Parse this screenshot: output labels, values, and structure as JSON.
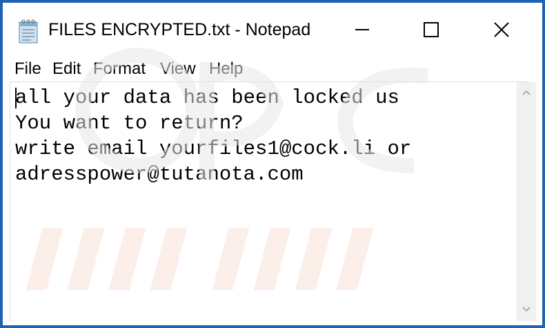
{
  "window": {
    "title": "FILES ENCRYPTED.txt - Notepad",
    "icon": "notepad-icon"
  },
  "controls": {
    "minimize_icon": "minimize-icon",
    "maximize_icon": "maximize-icon",
    "close_icon": "close-icon"
  },
  "menu": {
    "items": [
      "File",
      "Edit",
      "Format",
      "View",
      "Help"
    ]
  },
  "editor": {
    "lines": [
      "all your data has been locked us",
      "You want to return?",
      "write email yourfiles1@cock.li or",
      "adresspower@tutanota.com"
    ]
  },
  "colors": {
    "frame": "#1d62b3",
    "background": "#ffffff",
    "text": "#000000"
  }
}
